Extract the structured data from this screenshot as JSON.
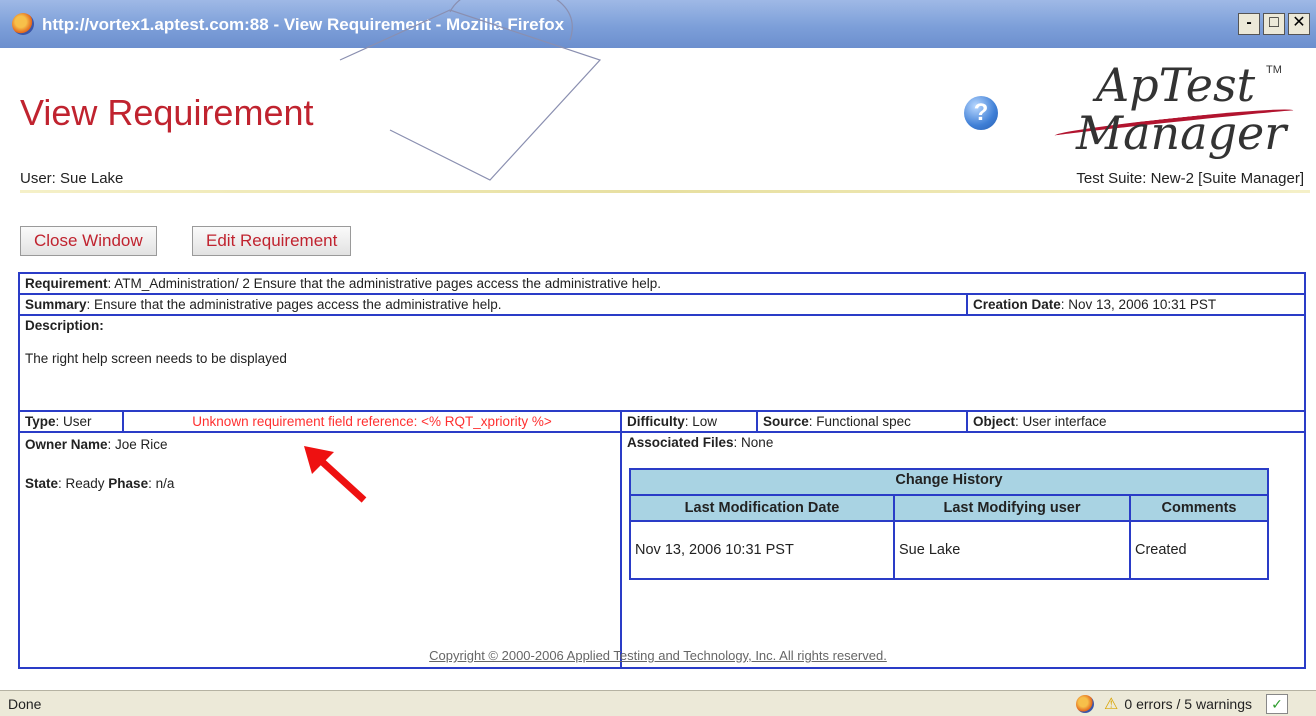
{
  "window": {
    "title": "http://vortex1.aptest.com:88 - View Requirement - Mozilla Firefox",
    "minimize_label": "-",
    "maximize_label": "□",
    "close_label": "✕"
  },
  "header": {
    "page_title": "View Requirement",
    "help_icon_glyph": "?",
    "logo_line1": "ApTest",
    "logo_line2": "Manager",
    "logo_tm": "TM",
    "user": "User: Sue Lake",
    "test_suite": "Test Suite: New-2 [Suite Manager]"
  },
  "actions": {
    "close_window": "Close Window",
    "edit_requirement": "Edit Requirement"
  },
  "requirement": {
    "requirement_label": "Requirement",
    "requirement_value": ": ATM_Administration/  2 Ensure that the administrative pages access the administrative help.",
    "summary_label": "Summary",
    "summary_value": ": Ensure that the administrative pages access the administrative help.",
    "creation_date_label": "Creation Date",
    "creation_date_value": ": Nov 13, 2006 10:31 PST",
    "description_label": "Description",
    "description_colon": ":",
    "description_value": "The right help screen needs to be displayed",
    "type_label": "Type",
    "type_value": ": User",
    "error_text": "Unknown requirement field reference: <% RQT_xpriority %>",
    "difficulty_label": "Difficulty",
    "difficulty_value": ": Low",
    "source_label": "Source",
    "source_value": ": Functional spec",
    "object_label": "Object",
    "object_value": ": User interface",
    "owner_label": "Owner Name",
    "owner_value": ": Joe Rice",
    "state_label": "State",
    "state_value": ": Ready ",
    "phase_label": "Phase",
    "phase_value": ": n/a",
    "associated_files_label": "Associated Files",
    "associated_files_value": ": None"
  },
  "change_history": {
    "title": "Change History",
    "columns": [
      "Last Modification Date",
      "Last Modifying user",
      "Comments"
    ],
    "rows": [
      [
        "Nov 13, 2006 10:31 PST",
        "Sue Lake",
        "Created"
      ]
    ]
  },
  "footer": {
    "copyright": "Copyright © 2000-2006 Applied Testing and Technology, Inc. All rights reserved."
  },
  "status_bar": {
    "status": "Done",
    "warnings": "0 errors / 5 warnings"
  },
  "colors": {
    "title_red": "#c0232f",
    "table_border": "#2a3cc7",
    "error_red": "#ff3030",
    "header_cell_bg": "#a9d3e3",
    "titlebar_blue": "#7d9fd9"
  }
}
